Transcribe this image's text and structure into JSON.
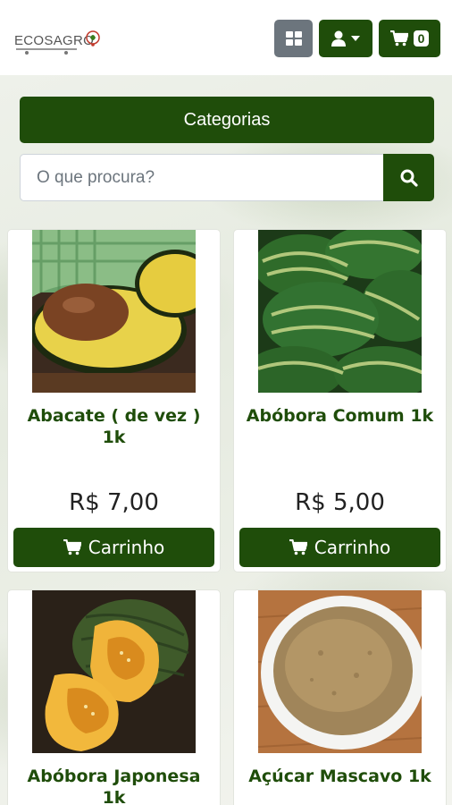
{
  "header": {
    "logo_text": "ECOSAGRO",
    "cart_count": "0",
    "icons": {
      "grid": "grid-icon",
      "user": "user-icon",
      "caret": "caret-down-icon",
      "cart": "cart-icon"
    }
  },
  "categories_label": "Categorias",
  "search": {
    "placeholder": "O que procura?",
    "icon": "search-icon"
  },
  "products": [
    {
      "name": "Abacate ( de vez ) 1k",
      "price": "R$ 7,00",
      "button": "Carrinho"
    },
    {
      "name": "Abóbora Comum 1k",
      "price": "R$ 5,00",
      "button": "Carrinho"
    },
    {
      "name": "Abóbora Japonesa 1k"
    },
    {
      "name": "Açúcar Mascavo 1k"
    }
  ],
  "colors": {
    "primary": "#1f4d0a",
    "secondary": "#6c757d"
  }
}
